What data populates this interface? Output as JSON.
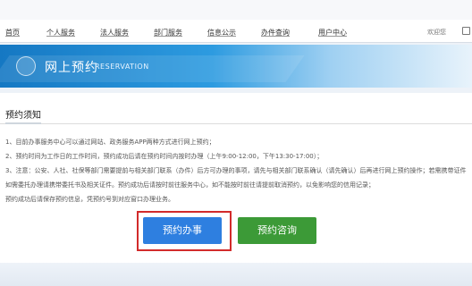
{
  "nav": {
    "items": [
      "首页",
      "个人服务",
      "法人服务",
      "部门服务",
      "信息公示",
      "办件查询",
      "用户中心"
    ],
    "right_text": "欢迎您"
  },
  "banner": {
    "title": "网上预约",
    "subtitle": "RESERVATION"
  },
  "section": {
    "title": "预约须知"
  },
  "notices": [
    "1、目前办事服务中心可以通过网站、政务服务APP两种方式进行网上预约；",
    "2、预约时间为工作日的工作时间，预约成功后请在预约时间内按时办理（上午9:00-12:00，下午13:30-17:00）；",
    "3、注意：公安、人社、社保等部门需要提前与相关部门联系（办件）后方可办理的事项，请先与相关部门联系确认（请先确认）后再进行网上预约操作；若需携带证件，请携带本人身份证原件到现场办理，",
    "如需委托办理请携带委托书及相关证件。预约成功后请按时前往服务中心，如不能按时前往请提前取消预约，以免影响您的信用记录；",
    "预约成功后请保存预约信息，凭预约号到对应窗口办理业务。"
  ],
  "buttons": {
    "book": "预约办事",
    "consult": "预约咨询"
  }
}
